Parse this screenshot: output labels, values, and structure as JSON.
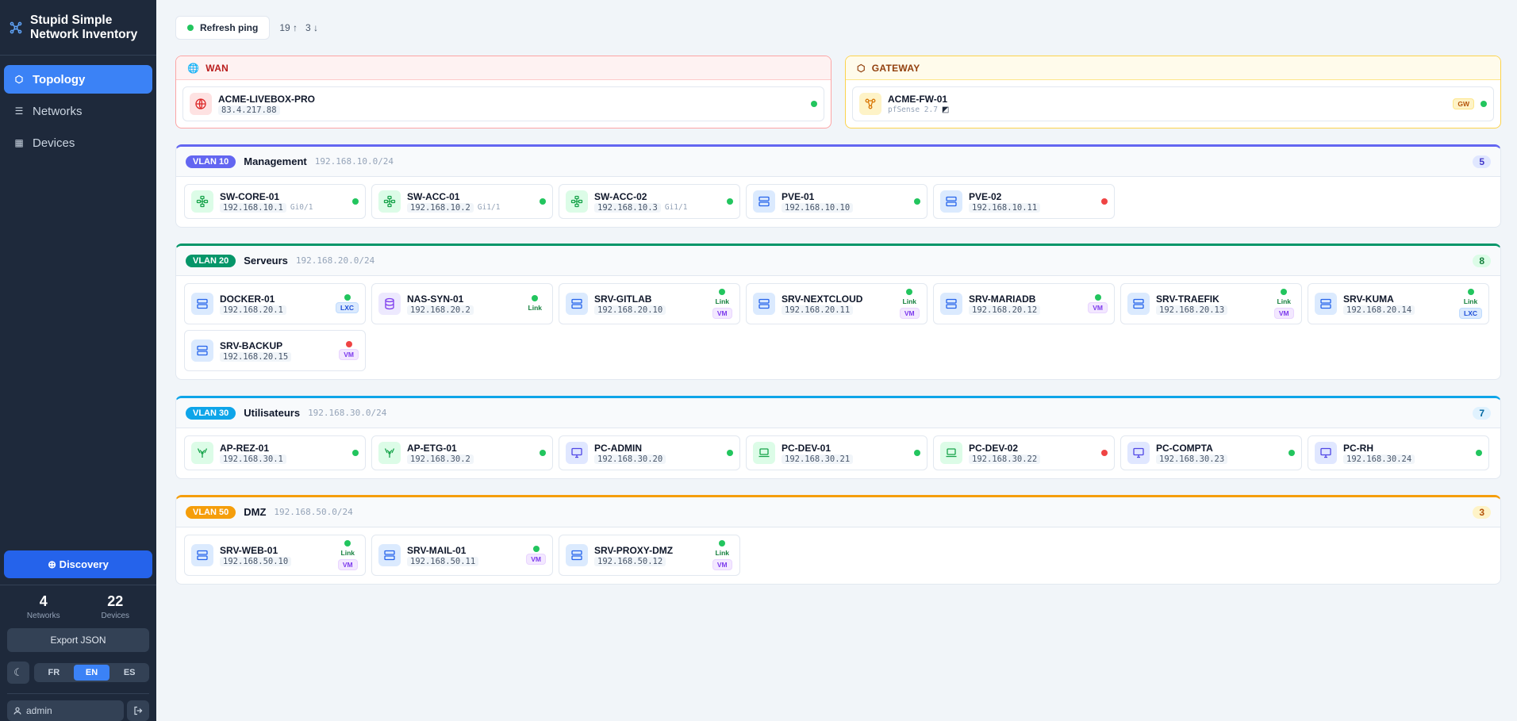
{
  "app": {
    "title": "Stupid Simple Network Inventory"
  },
  "nav": [
    {
      "label": "Topology",
      "icon": "hexagon-icon",
      "active": true
    },
    {
      "label": "Networks",
      "icon": "list-icon",
      "active": false
    },
    {
      "label": "Devices",
      "icon": "grid-icon",
      "active": false
    }
  ],
  "sidebar": {
    "discovery_label": "⊕ Discovery",
    "stats": {
      "networks_count": "4",
      "networks_label": "Networks",
      "devices_count": "22",
      "devices_label": "Devices"
    },
    "export_label": "Export JSON",
    "theme_icon": "☾",
    "languages": [
      {
        "code": "FR",
        "active": false
      },
      {
        "code": "EN",
        "active": true
      },
      {
        "code": "ES",
        "active": false
      }
    ],
    "user": "admin"
  },
  "toolbar": {
    "refresh_label": "Refresh ping",
    "up_count": "19 ↑",
    "down_count": "3 ↓"
  },
  "wan": {
    "label": "WAN",
    "device": {
      "name": "ACME-LIVEBOX-PRO",
      "ip": "83.4.217.88",
      "status": "up"
    }
  },
  "gateway": {
    "label": "GATEWAY",
    "device": {
      "name": "ACME-FW-01",
      "sub": "pfSense 2.7",
      "tag": "GW",
      "status": "up"
    }
  },
  "vlans": [
    {
      "badge": "VLAN 10",
      "name": "Management",
      "cidr": "192.168.10.0/24",
      "count": "5",
      "color": "#6366f1",
      "count_bg": "#e0e7ff",
      "count_fg": "#4338ca",
      "devices": [
        {
          "name": "SW-CORE-01",
          "ip": "192.168.10.1",
          "port": "Gi0/1",
          "kind": "switch",
          "status": "up"
        },
        {
          "name": "SW-ACC-01",
          "ip": "192.168.10.2",
          "port": "Gi1/1",
          "kind": "switch",
          "status": "up"
        },
        {
          "name": "SW-ACC-02",
          "ip": "192.168.10.3",
          "port": "Gi1/1",
          "kind": "switch",
          "status": "up"
        },
        {
          "name": "PVE-01",
          "ip": "192.168.10.10",
          "port": "",
          "kind": "server",
          "status": "up"
        },
        {
          "name": "PVE-02",
          "ip": "192.168.10.11",
          "port": "",
          "kind": "server",
          "status": "down"
        }
      ]
    },
    {
      "badge": "VLAN 20",
      "name": "Serveurs",
      "cidr": "192.168.20.0/24",
      "count": "8",
      "color": "#059669",
      "count_bg": "#dcfce7",
      "count_fg": "#15803d",
      "devices": [
        {
          "name": "DOCKER-01",
          "ip": "192.168.20.1",
          "kind": "server",
          "status": "up",
          "tags": [
            "LXC"
          ]
        },
        {
          "name": "NAS-SYN-01",
          "ip": "192.168.20.2",
          "kind": "nas",
          "status": "up",
          "tags": [
            "Link"
          ]
        },
        {
          "name": "SRV-GITLAB",
          "ip": "192.168.20.10",
          "kind": "server",
          "status": "up",
          "tags": [
            "Link",
            "VM"
          ]
        },
        {
          "name": "SRV-NEXTCLOUD",
          "ip": "192.168.20.11",
          "kind": "server",
          "status": "up",
          "tags": [
            "Link",
            "VM"
          ]
        },
        {
          "name": "SRV-MARIADB",
          "ip": "192.168.20.12",
          "kind": "server",
          "status": "up",
          "tags": [
            "VM"
          ]
        },
        {
          "name": "SRV-TRAEFIK",
          "ip": "192.168.20.13",
          "kind": "server",
          "status": "up",
          "tags": [
            "Link",
            "VM"
          ]
        },
        {
          "name": "SRV-KUMA",
          "ip": "192.168.20.14",
          "kind": "server",
          "status": "up",
          "tags": [
            "Link",
            "LXC"
          ]
        },
        {
          "name": "SRV-BACKUP",
          "ip": "192.168.20.15",
          "kind": "server",
          "status": "down",
          "tags": [
            "VM"
          ]
        }
      ]
    },
    {
      "badge": "VLAN 30",
      "name": "Utilisateurs",
      "cidr": "192.168.30.0/24",
      "count": "7",
      "color": "#0ea5e9",
      "count_bg": "#e0f2fe",
      "count_fg": "#0369a1",
      "devices": [
        {
          "name": "AP-REZ-01",
          "ip": "192.168.30.1",
          "kind": "ap",
          "status": "up"
        },
        {
          "name": "AP-ETG-01",
          "ip": "192.168.30.2",
          "kind": "ap",
          "status": "up"
        },
        {
          "name": "PC-ADMIN",
          "ip": "192.168.30.20",
          "kind": "pc",
          "status": "up"
        },
        {
          "name": "PC-DEV-01",
          "ip": "192.168.30.21",
          "kind": "laptop",
          "status": "up"
        },
        {
          "name": "PC-DEV-02",
          "ip": "192.168.30.22",
          "kind": "laptop",
          "status": "down"
        },
        {
          "name": "PC-COMPTA",
          "ip": "192.168.30.23",
          "kind": "pc",
          "status": "up"
        },
        {
          "name": "PC-RH",
          "ip": "192.168.30.24",
          "kind": "pc",
          "status": "up"
        }
      ]
    },
    {
      "badge": "VLAN 50",
      "name": "DMZ",
      "cidr": "192.168.50.0/24",
      "count": "3",
      "color": "#f59e0b",
      "count_bg": "#fef3c7",
      "count_fg": "#b45309",
      "devices": [
        {
          "name": "SRV-WEB-01",
          "ip": "192.168.50.10",
          "kind": "server",
          "status": "up",
          "tags": [
            "Link",
            "VM"
          ]
        },
        {
          "name": "SRV-MAIL-01",
          "ip": "192.168.50.11",
          "kind": "server",
          "status": "up",
          "tags": [
            "VM"
          ]
        },
        {
          "name": "SRV-PROXY-DMZ",
          "ip": "192.168.50.12",
          "kind": "server",
          "status": "up",
          "tags": [
            "Link",
            "VM"
          ]
        }
      ]
    }
  ]
}
